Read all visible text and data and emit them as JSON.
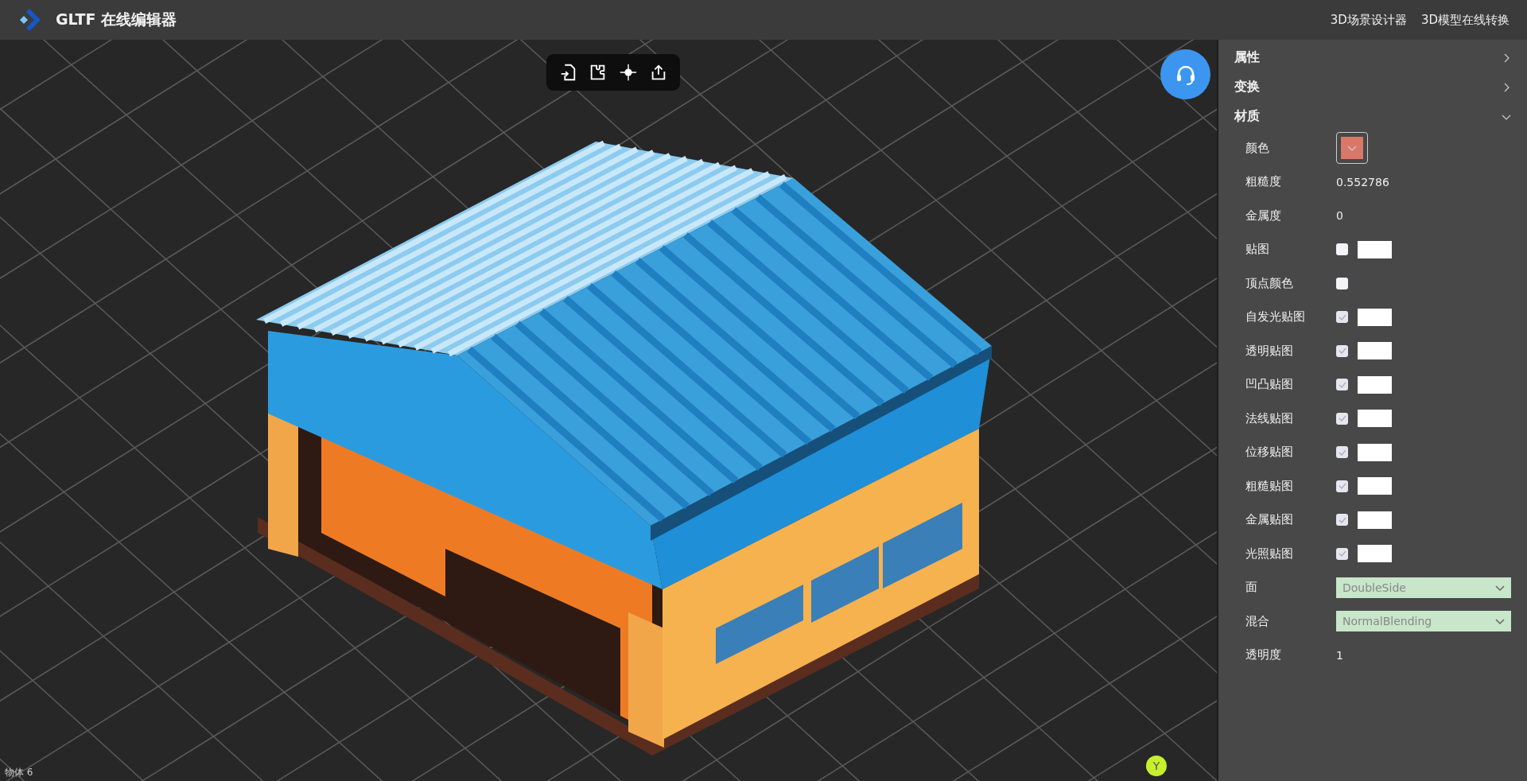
{
  "header": {
    "title": "GLTF 在线编辑器",
    "links": [
      {
        "label": "3D场景设计器"
      },
      {
        "label": "3D模型在线转换"
      }
    ]
  },
  "viewport": {
    "object_count": "物体 6",
    "axis_label": "Y"
  },
  "panel": {
    "sections": [
      {
        "title": "属性",
        "expanded": false
      },
      {
        "title": "变换",
        "expanded": false
      },
      {
        "title": "材质",
        "expanded": true
      }
    ],
    "rows": [
      {
        "kind": "color",
        "label": "颜色",
        "color": "#d97868"
      },
      {
        "kind": "value",
        "label": "粗糙度",
        "value": "0.552786"
      },
      {
        "kind": "value",
        "label": "金属度",
        "value": "0"
      },
      {
        "kind": "texture",
        "label": "贴图",
        "checked": false
      },
      {
        "kind": "checkbox",
        "label": "顶点颜色",
        "checked": false
      },
      {
        "kind": "texture",
        "label": "自发光贴图",
        "checked": true
      },
      {
        "kind": "texture",
        "label": "透明贴图",
        "checked": true
      },
      {
        "kind": "texture",
        "label": "凹凸贴图",
        "checked": true
      },
      {
        "kind": "texture",
        "label": "法线贴图",
        "checked": true
      },
      {
        "kind": "texture",
        "label": "位移贴图",
        "checked": true
      },
      {
        "kind": "texture",
        "label": "粗糙贴图",
        "checked": true
      },
      {
        "kind": "texture",
        "label": "金属贴图",
        "checked": true
      },
      {
        "kind": "texture",
        "label": "光照贴图",
        "checked": true
      },
      {
        "kind": "select",
        "label": "面",
        "value": "DoubleSide"
      },
      {
        "kind": "select",
        "label": "混合",
        "value": "NormalBlending"
      },
      {
        "kind": "value",
        "label": "透明度",
        "value": "1"
      }
    ]
  }
}
